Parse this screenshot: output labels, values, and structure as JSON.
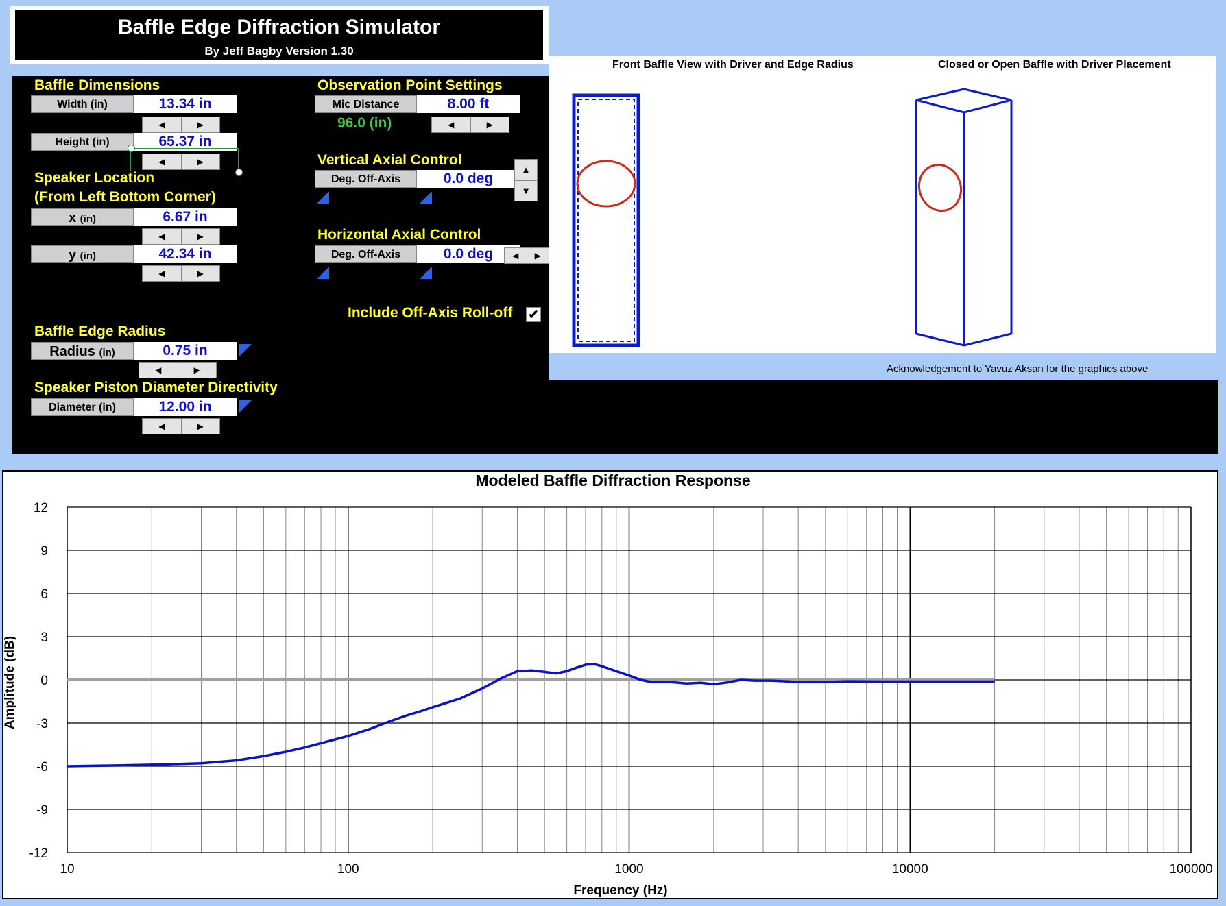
{
  "title": {
    "main": "Baffle Edge Diffraction Simulator",
    "sub": "By Jeff Bagby Version 1.30"
  },
  "baffle_dimensions": {
    "heading": "Baffle Dimensions",
    "width_label": "Width (in)",
    "width_value": "13.34 in",
    "height_label": "Height (in)",
    "height_value": "65.37 in"
  },
  "speaker_location": {
    "heading_line1": "Speaker Location",
    "heading_line2": "(From Left Bottom Corner)",
    "x_label_big": "x",
    "x_label_small": "(in)",
    "x_value": "6.67 in",
    "y_label_big": "y",
    "y_label_small": "(in)",
    "y_value": "42.34 in"
  },
  "baffle_edge": {
    "heading": "Baffle Edge Radius",
    "radius_label_big": "Radius",
    "radius_label_small": "(in)",
    "radius_value": "0.75 in"
  },
  "piston": {
    "heading": "Speaker Piston Diameter Directivity",
    "diameter_label": "Diameter (in)",
    "diameter_value": "12.00 in"
  },
  "observation": {
    "heading": "Observation Point Settings",
    "mic_label": "Mic Distance",
    "mic_value": "8.00 ft",
    "mic_inches": "96.0 (in)"
  },
  "vertical_axial": {
    "heading": "Vertical Axial Control",
    "label": "Deg. Off-Axis",
    "value": "0.0 deg"
  },
  "horizontal_axial": {
    "heading": "Horizontal Axial Control",
    "label": "Deg. Off-Axis",
    "value": "0.0 deg"
  },
  "rolloff": {
    "label": "Include Off-Axis Roll-off",
    "checked_glyph": "✔"
  },
  "spinner": {
    "left": "◀",
    "right": "▶",
    "up": "▲",
    "down": "▼"
  },
  "graphics": {
    "front_title": "Front Baffle View with Driver and Edge Radius",
    "box_title": "Closed or Open Baffle with Driver Placement",
    "acknowledgement": "Acknowledgement to Yavuz Aksan for the graphics above"
  },
  "colors": {
    "baffle_blue": "#0a1ccc",
    "driver_red": "#cc2a1a",
    "response_blue": "#0a12c8",
    "reference_gray": "#a0a0a0",
    "label_blue": "#1010c8",
    "heading_yellow": "#ffff33",
    "mic_green": "#3cc83c"
  },
  "chart_data": {
    "type": "line",
    "title": "Modeled Baffle Diffraction Response",
    "xlabel": "Frequency (Hz)",
    "ylabel": "Amplitude (dB)",
    "x_scale": "log",
    "xlim": [
      10,
      100000
    ],
    "ylim": [
      -12,
      12
    ],
    "x_ticks": [
      "10",
      "100",
      "1000",
      "10000",
      "100000"
    ],
    "y_ticks": [
      "12",
      "9",
      "6",
      "3",
      "0",
      "-3",
      "-6",
      "-9",
      "-12"
    ],
    "grid": true,
    "series": [
      {
        "x": [
          10,
          15,
          20,
          30,
          40,
          50,
          60,
          70,
          80,
          100,
          120,
          140,
          160,
          180,
          200,
          250,
          300,
          350,
          400,
          450,
          500,
          550,
          600,
          650,
          700,
          750,
          800,
          900,
          1000,
          1100,
          1200,
          1400,
          1600,
          1800,
          2000,
          2200,
          2500,
          2800,
          3200,
          3600,
          4000,
          5000,
          6000,
          8000,
          10000,
          15000,
          20000
        ],
        "y": [
          -6.0,
          -5.95,
          -5.9,
          -5.8,
          -5.6,
          -5.3,
          -5.0,
          -4.7,
          -4.4,
          -3.9,
          -3.4,
          -2.9,
          -2.5,
          -2.2,
          -1.9,
          -1.3,
          -0.6,
          0.1,
          0.6,
          0.65,
          0.55,
          0.45,
          0.6,
          0.85,
          1.05,
          1.1,
          0.95,
          0.6,
          0.3,
          0.0,
          -0.15,
          -0.15,
          -0.25,
          -0.2,
          -0.3,
          -0.2,
          0.0,
          -0.05,
          -0.05,
          -0.1,
          -0.15,
          -0.15,
          -0.1,
          -0.12,
          -0.12,
          -0.12,
          -0.12
        ]
      },
      {
        "x": [
          10,
          20000
        ],
        "y": [
          0,
          0
        ]
      }
    ]
  }
}
